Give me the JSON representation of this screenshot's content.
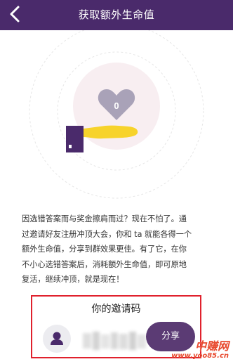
{
  "header": {
    "title": "获取额外生命值",
    "back_icon": "chevron-left-icon"
  },
  "hero": {
    "life_count": "0",
    "heart_icon": "heart-icon",
    "hand_icon": "hand-holding-icon"
  },
  "description": {
    "lines": [
      "因选错答案而与奖金擦肩而过？现在不怕了。通",
      "过邀请好友注册冲顶大会，你和 ta 就能各得一个",
      "额外生命值，分享到群效果更佳。有了它，在你",
      "不小心选错答案后，消耗额外生命值，即可原地",
      "复活，继续冲顶，就是现在！"
    ]
  },
  "invite": {
    "title": "你的邀请码",
    "share_label": "分享",
    "avatar_icon": "user-icon"
  },
  "watermark": {
    "top": "中赚网",
    "bottom": "www.yoo85.cn"
  },
  "colors": {
    "header_bg": "#4a2a6b",
    "accent": "#5b3b74",
    "hand": "#f7d32b",
    "highlight_border": "#e0212d"
  }
}
